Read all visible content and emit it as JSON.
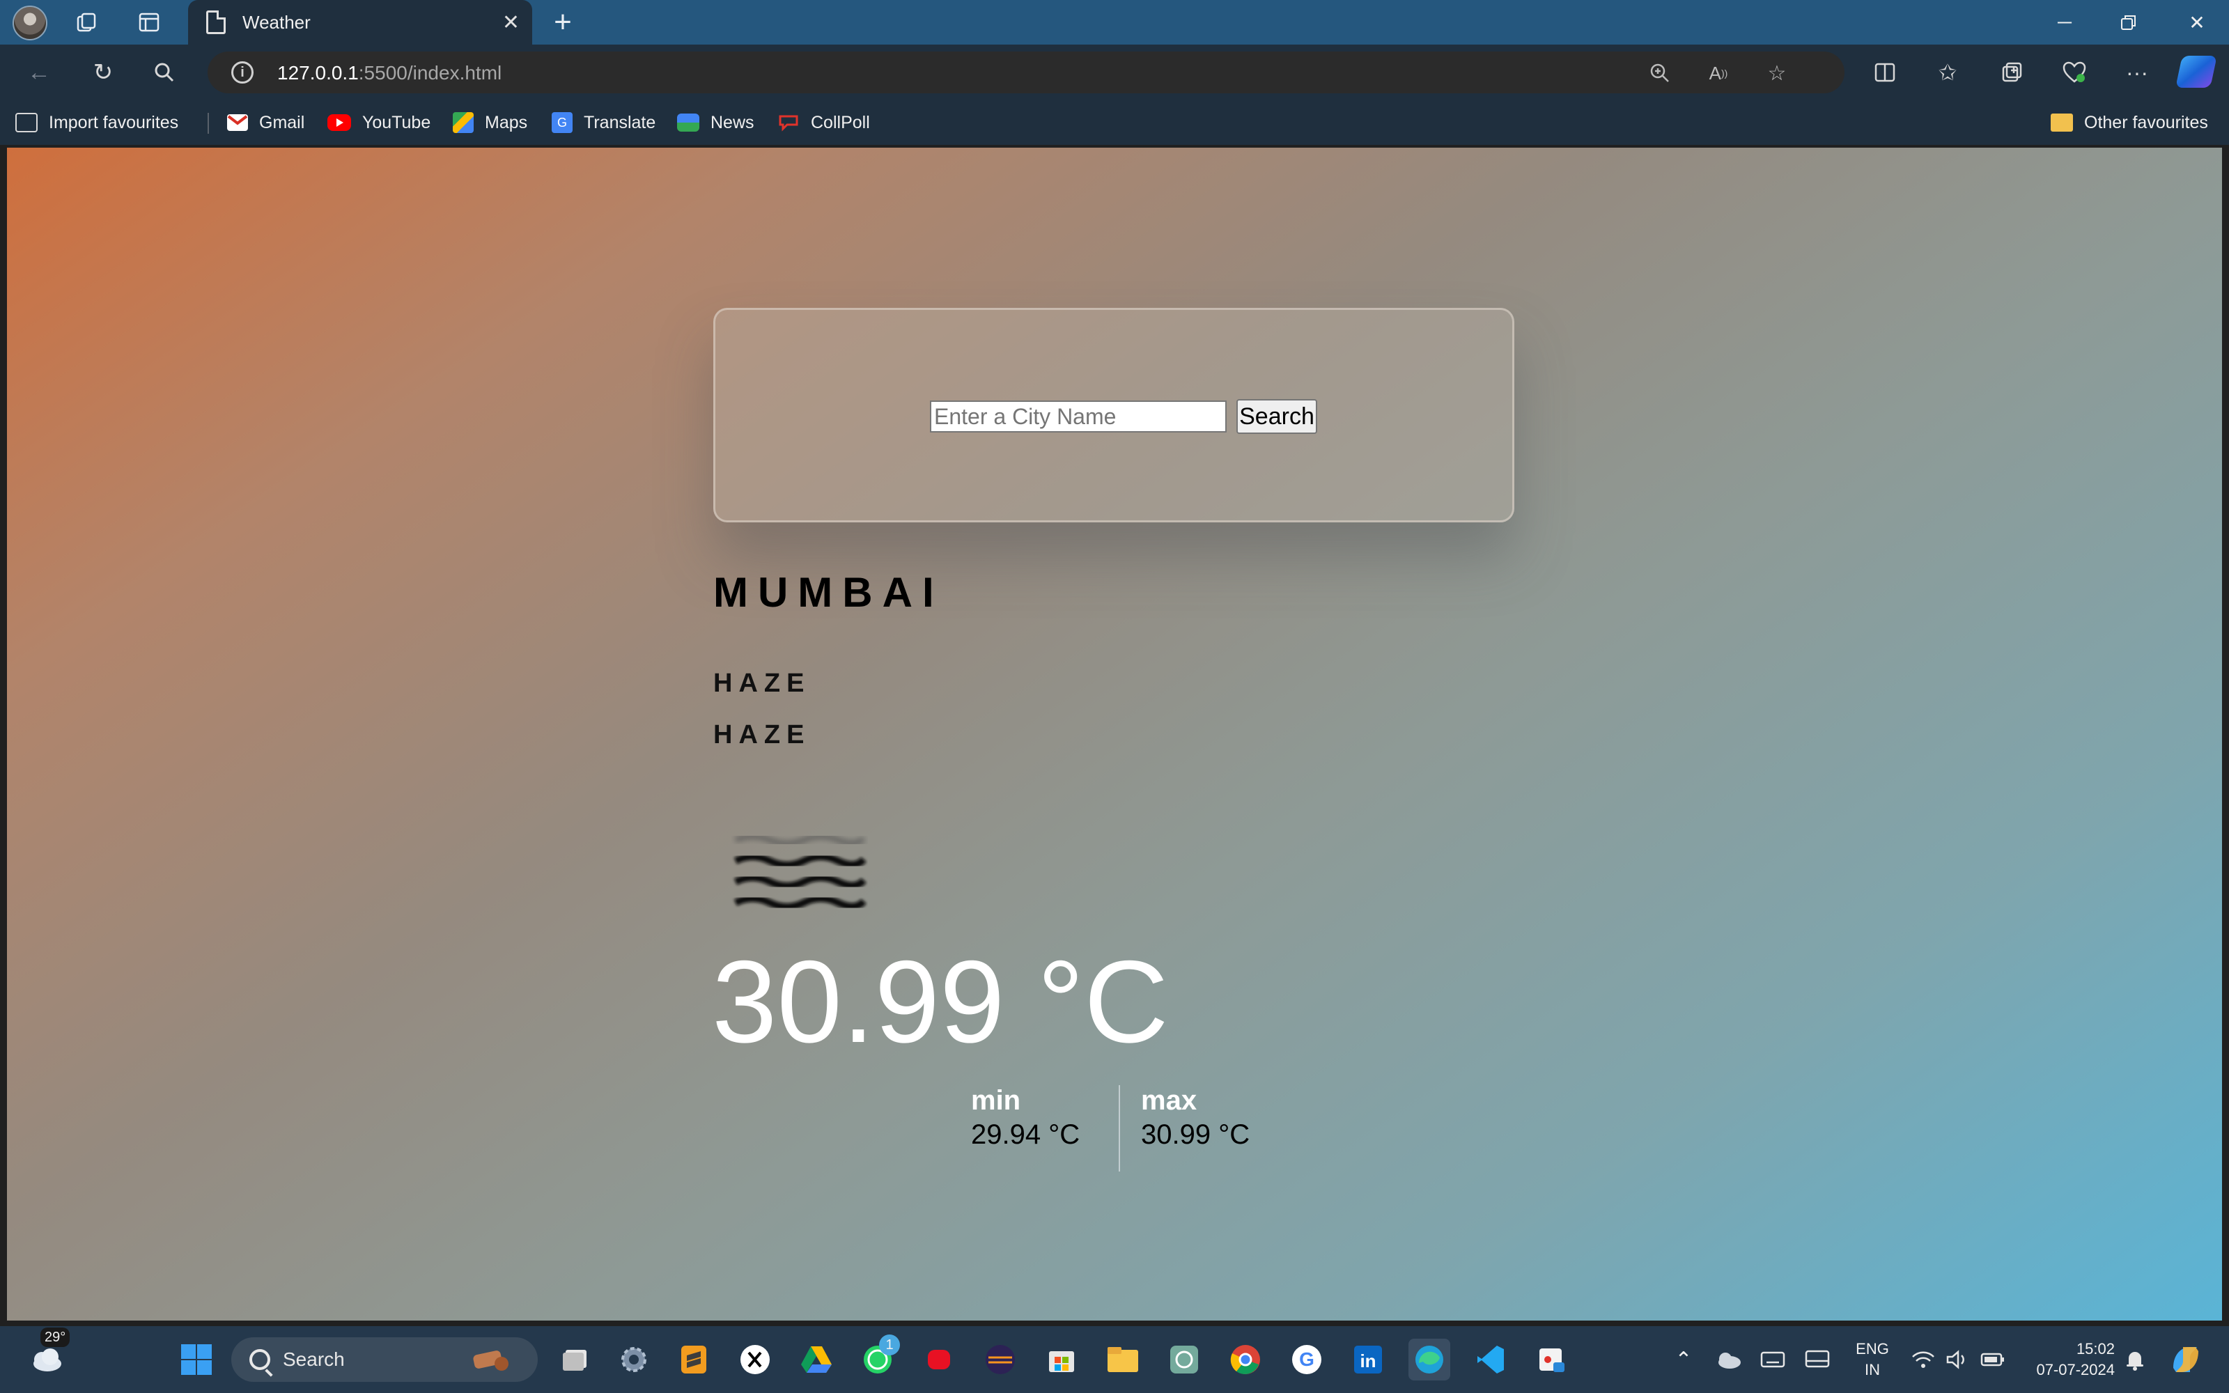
{
  "browser": {
    "tab_title": "Weather",
    "url_host": "127.0.0.1",
    "url_path": ":5500/index.html",
    "favourites": [
      "Import favourites",
      "Gmail",
      "YouTube",
      "Maps",
      "Translate",
      "News",
      "CollPoll"
    ],
    "other_favourites": "Other favourites"
  },
  "app": {
    "search_placeholder": "Enter a City Name",
    "search_button": "Search",
    "city": "MUMBAI",
    "condition_main": "HAZE",
    "condition_description": "HAZE",
    "weather_icon": "haze-icon",
    "temperature": "30.99 °C",
    "min_label": "min",
    "min_value": "29.94 °C",
    "max_label": "max",
    "max_value": "30.99 °C",
    "background_colors": [
      "#cf6f3d",
      "#5ab4d6"
    ]
  },
  "taskbar": {
    "weather_temp": "29°",
    "search_label": "Search",
    "whatsapp_badge": "1",
    "lang_line1": "ENG",
    "lang_line2": "IN",
    "time": "15:02",
    "date": "07-07-2024"
  }
}
